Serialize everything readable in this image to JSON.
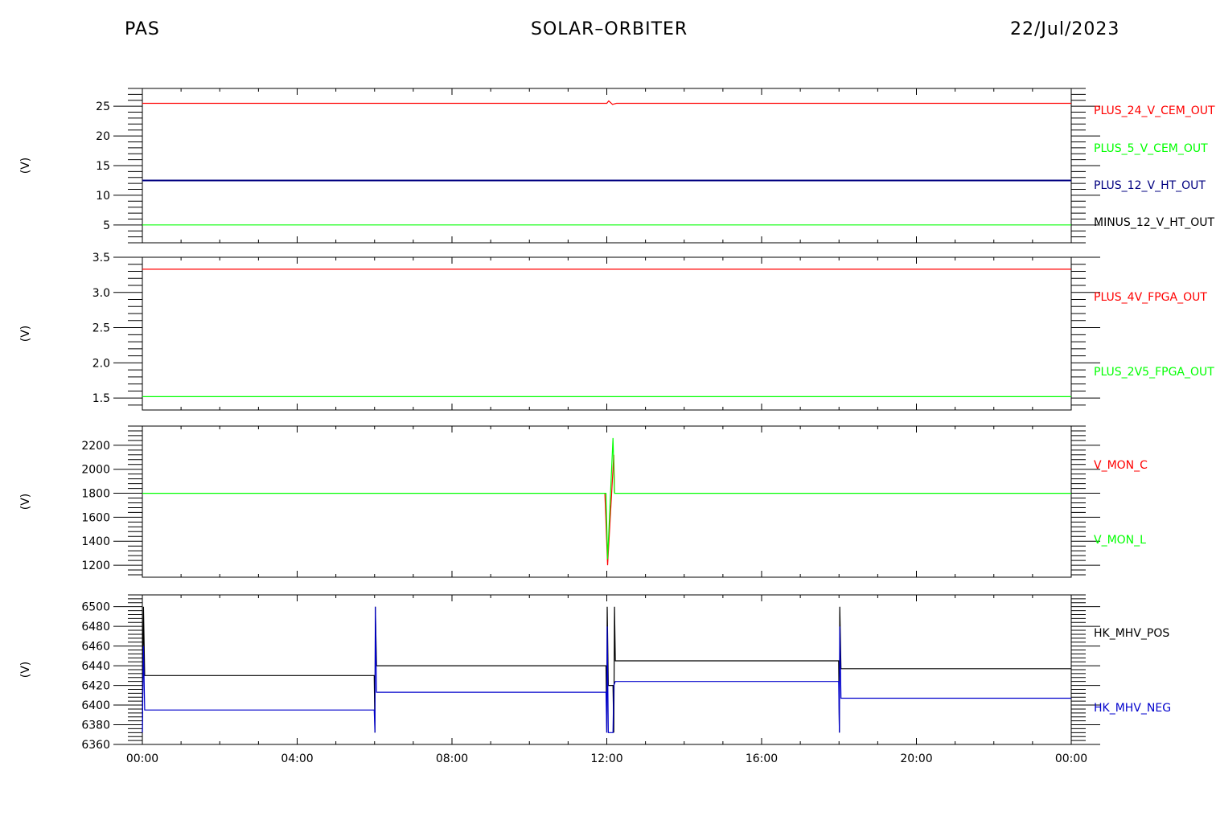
{
  "header": {
    "left": "PAS",
    "center": "SOLAR–ORBITER",
    "right": "22/Jul/2023"
  },
  "chart_data": [
    {
      "type": "line",
      "ylabel": "(V)",
      "ylim": [
        2,
        28
      ],
      "yticks": [
        5,
        10,
        15,
        20,
        25
      ],
      "x": [
        "00:00",
        "04:00",
        "08:00",
        "12:00",
        "16:00",
        "20:00",
        "00:00"
      ],
      "series": [
        {
          "name": "PLUS_24_V_CEM_OUT",
          "color": "#ff0000",
          "values": [
            [
              0,
              25.5
            ],
            [
              12.0,
              25.5
            ],
            [
              12.05,
              25.9
            ],
            [
              12.15,
              25.3
            ],
            [
              12.25,
              25.5
            ],
            [
              24,
              25.5
            ]
          ]
        },
        {
          "name": "PLUS_5_V_CEM_OUT",
          "color": "#00ff00",
          "values": [
            [
              0,
              5.0
            ],
            [
              24,
              5.0
            ]
          ]
        },
        {
          "name": "PLUS_12_V_HT_OUT",
          "color": "#000080",
          "values": [
            [
              0,
              12.5
            ],
            [
              24,
              12.5
            ]
          ]
        },
        {
          "name": "MINUS_12_V_HT_OUT",
          "color": "#000000",
          "values": []
        }
      ]
    },
    {
      "type": "line",
      "ylabel": "(V)",
      "ylim": [
        1.33,
        3.5
      ],
      "yticks": [
        1.5,
        2.0,
        2.5,
        3.0,
        3.5
      ],
      "x": [
        "00:00",
        "04:00",
        "08:00",
        "12:00",
        "16:00",
        "20:00",
        "00:00"
      ],
      "series": [
        {
          "name": "PLUS_4V_FPGA_OUT",
          "color": "#ff0000",
          "values": [
            [
              0,
              3.33
            ],
            [
              24,
              3.33
            ]
          ]
        },
        {
          "name": "PLUS_2V5_FPGA_OUT",
          "color": "#00ff00",
          "values": [
            [
              0,
              1.52
            ],
            [
              24,
              1.52
            ]
          ]
        }
      ]
    },
    {
      "type": "line",
      "ylabel": "(V)",
      "ylim": [
        1100,
        2360
      ],
      "yticks": [
        1200,
        1400,
        1600,
        1800,
        2000,
        2200
      ],
      "x": [
        "00:00",
        "04:00",
        "08:00",
        "12:00",
        "16:00",
        "20:00",
        "00:00"
      ],
      "series": [
        {
          "name": "V_MON_C",
          "color": "#ff0000",
          "values": [
            [
              11.95,
              1800
            ],
            [
              12.02,
              1200
            ],
            [
              12.18,
              2120
            ],
            [
              12.2,
              1800
            ]
          ]
        },
        {
          "name": "V_MON_L",
          "color": "#00ff00",
          "values": [
            [
              0,
              1800
            ],
            [
              11.98,
              1800
            ],
            [
              12.02,
              1250
            ],
            [
              12.16,
              2260
            ],
            [
              12.2,
              1800
            ],
            [
              24,
              1800
            ]
          ]
        }
      ]
    },
    {
      "type": "line",
      "ylabel": "(V)",
      "ylim": [
        6360,
        6512
      ],
      "yticks": [
        6360,
        6380,
        6400,
        6420,
        6440,
        6460,
        6480,
        6500
      ],
      "x": [
        "00:00",
        "04:00",
        "08:00",
        "12:00",
        "16:00",
        "20:00",
        "00:00"
      ],
      "xlabels": [
        "00:00",
        "04:00",
        "08:00",
        "12:00",
        "16:00",
        "20:00",
        "00:00"
      ],
      "series": [
        {
          "name": "HK_MHV_POS",
          "color": "#000000",
          "values": [
            [
              0,
              6372
            ],
            [
              0.03,
              6500
            ],
            [
              0.06,
              6430
            ],
            [
              5.99,
              6430
            ],
            [
              6.01,
              6372
            ],
            [
              6.02,
              6500
            ],
            [
              6.05,
              6440
            ],
            [
              11.98,
              6440
            ],
            [
              12.0,
              6372
            ],
            [
              12.01,
              6500
            ],
            [
              12.04,
              6420
            ],
            [
              12.16,
              6420
            ],
            [
              12.18,
              6372
            ],
            [
              12.2,
              6500
            ],
            [
              12.22,
              6445
            ],
            [
              17.99,
              6445
            ],
            [
              18.01,
              6372
            ],
            [
              18.02,
              6500
            ],
            [
              18.05,
              6437
            ],
            [
              24,
              6437
            ]
          ]
        },
        {
          "name": "HK_MHV_NEG",
          "color": "#0000cc",
          "values": [
            [
              0,
              6372
            ],
            [
              0.03,
              6460
            ],
            [
              0.06,
              6395
            ],
            [
              5.99,
              6395
            ],
            [
              6.01,
              6372
            ],
            [
              6.02,
              6500
            ],
            [
              6.05,
              6413
            ],
            [
              11.98,
              6413
            ],
            [
              12.0,
              6372
            ],
            [
              12.01,
              6480
            ],
            [
              12.04,
              6372
            ],
            [
              12.16,
              6372
            ],
            [
              12.18,
              6420
            ],
            [
              12.22,
              6424
            ],
            [
              17.99,
              6424
            ],
            [
              18.01,
              6372
            ],
            [
              18.02,
              6480
            ],
            [
              18.05,
              6407
            ],
            [
              24,
              6407
            ]
          ]
        }
      ]
    }
  ]
}
